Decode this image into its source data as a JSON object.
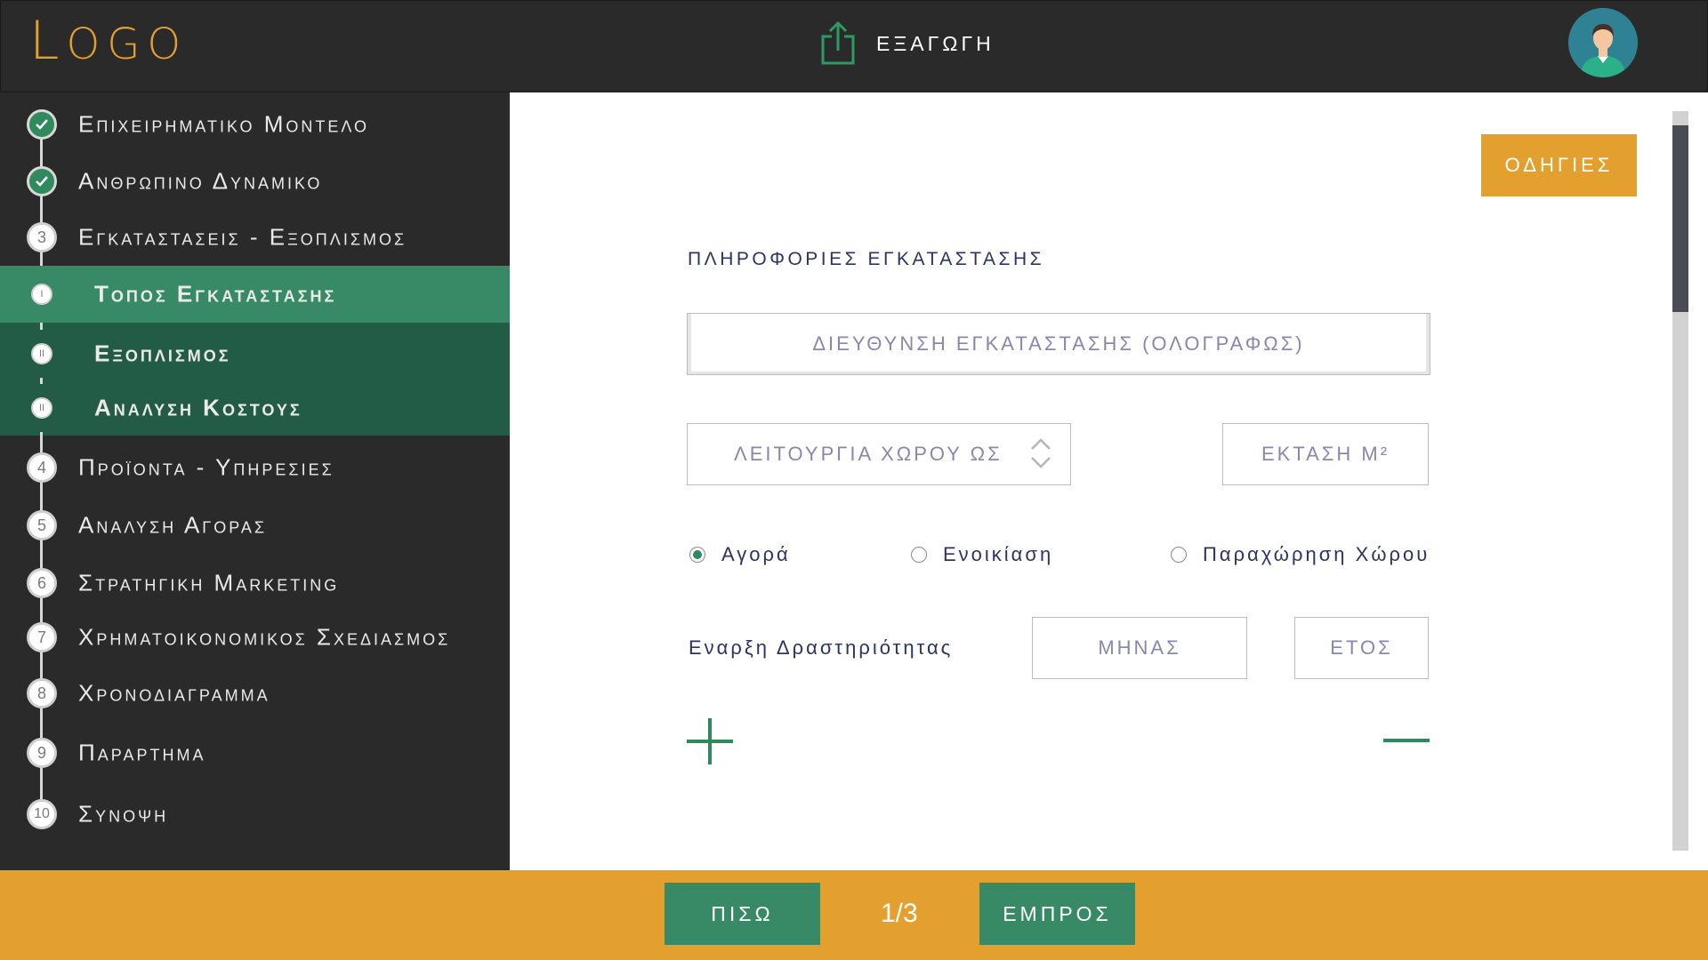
{
  "header": {
    "logo_first": "L",
    "logo_rest": "OGO",
    "export_label": "ΕΞΑΓΩΓΗ",
    "export_icon": "export-share-icon",
    "avatar_icon": "user-avatar-icon"
  },
  "sidebar": {
    "items": [
      {
        "marker": "✓",
        "label": "Επιχειρηματικο Μοντελο",
        "state": "done"
      },
      {
        "marker": "✓",
        "label": "Ανθρωπινο Δυναμικο",
        "state": "done"
      },
      {
        "marker": "3",
        "label": "Εγκαταστασεις - Εξοπλισμος",
        "state": "current"
      },
      {
        "marker": "4",
        "label": "Προϊοντα - Υπηρεσιες",
        "state": "pending"
      },
      {
        "marker": "5",
        "label": "Αναλυση Αγορας",
        "state": "pending"
      },
      {
        "marker": "6",
        "label": "Στρατηγικη Marketing",
        "state": "pending"
      },
      {
        "marker": "7",
        "label": "Χρηματοικονομικος Σχεδιασμος",
        "state": "pending"
      },
      {
        "marker": "8",
        "label": "Χρονοδιαγραμμα",
        "state": "pending"
      },
      {
        "marker": "9",
        "label": "Παραρτημα",
        "state": "pending"
      },
      {
        "marker": "10",
        "label": "Συνοψη",
        "state": "pending"
      }
    ],
    "subitems": [
      {
        "marker": "I",
        "label": "Τοπος Εγκαταστασης",
        "active": true
      },
      {
        "marker": "II",
        "label": "Εξοπλισμος",
        "active": false
      },
      {
        "marker": "II",
        "label": "Αναλυση Κοστους",
        "active": false
      }
    ]
  },
  "main": {
    "help_button": "ΟΔΗΓΙΕΣ",
    "section_title": "ΠΛΗΡΟΦΟΡΙΕΣ ΕΓΚΑΤΑΣΤΑΣΗΣ",
    "address_placeholder": "ΔΙΕΥΘΥΝΣΗ ΕΓΚΑΤΑΣΤΑΣΗΣ (ΟΛΟΓΡΑΦΩΣ)",
    "usage_placeholder": "ΛΕΙΤΟΥΡΓΙΑ ΧΩΡΟΥ ΩΣ",
    "area_placeholder": "ΕΚΤΑΣΗ Μ²",
    "radios": [
      {
        "label": "Αγορά",
        "checked": true
      },
      {
        "label": "Ενοικίαση",
        "checked": false
      },
      {
        "label": "Παραχώρηση Χώρου",
        "checked": false
      }
    ],
    "start_label": "Εναρξη Δραστηριότητας",
    "month_placeholder": "ΜΗΝΑΣ",
    "year_placeholder": "ΕΤΟΣ",
    "add_icon": "plus-icon",
    "remove_icon": "minus-icon"
  },
  "footer": {
    "back_label": "ΠΙΣΩ",
    "page_indicator": "1/3",
    "next_label": "ΕΜΠΡΟΣ"
  },
  "colors": {
    "accent": "#e3a02f",
    "green": "#388a66",
    "dark_green": "#235c46",
    "dark_bg": "#2a2a2a",
    "navy_text": "#2b3463"
  }
}
